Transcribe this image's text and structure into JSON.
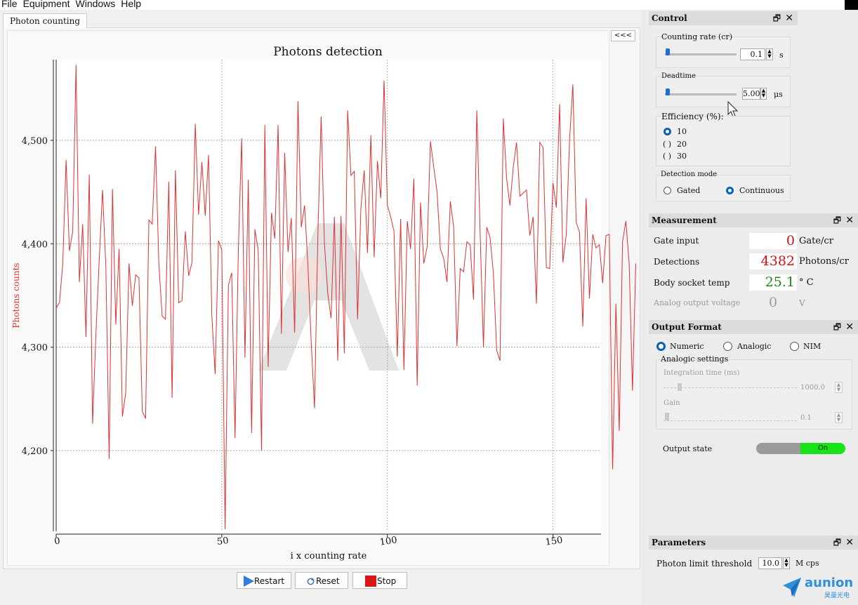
{
  "menu": [
    "File",
    "Equipment",
    "Windows",
    "Help"
  ],
  "tab": {
    "label": "Photon counting"
  },
  "collapse_label": "<<<",
  "chart_data": {
    "type": "line",
    "title": "Photons detection",
    "xlabel": "i x counting rate",
    "ylabel": "Photons counts",
    "xlim": [
      0,
      164.5
    ],
    "ylim": [
      4122,
      4578
    ],
    "xticks": [
      0,
      50,
      100,
      150
    ],
    "yticks": [
      4200,
      4300,
      4400,
      4500
    ],
    "ytick_labels": [
      "4,200",
      "4,300",
      "4,400",
      "4,500"
    ],
    "line_color": "#e03030",
    "grid": true,
    "series": [
      {
        "values": [
          4338,
          4343,
          4381,
          4481,
          4393,
          4412,
          4573,
          4363,
          4419,
          4310,
          4467,
          4226,
          4313,
          4384,
          4452,
          4378,
          4192,
          4453,
          4322,
          4395,
          4233,
          4256,
          4381,
          4340,
          4370,
          4367,
          4238,
          4231,
          4423,
          4419,
          4494,
          4381,
          4330,
          4327,
          4460,
          4251,
          4471,
          4343,
          4345,
          4412,
          4369,
          4382,
          4516,
          4428,
          4479,
          4427,
          4486,
          4331,
          4274,
          4403,
          4394,
          4124,
          4360,
          4372,
          4212,
          4394,
          4502,
          4290,
          4462,
          4217,
          4414,
          4394,
          4200,
          4515,
          4281,
          4430,
          4405,
          4515,
          4313,
          4488,
          4392,
          4425,
          4314,
          4538,
          4416,
          4437,
          4380,
          4305,
          4241,
          4407,
          4523,
          4400,
          4352,
          4328,
          4426,
          4287,
          4427,
          4294,
          4529,
          4466,
          4470,
          4327,
          4434,
          4471,
          4391,
          4505,
          4387,
          4480,
          4444,
          4558,
          4437,
          4426,
          4412,
          4291,
          4424,
          4278,
          4422,
          4395,
          4463,
          4263,
          4440,
          4381,
          4397,
          4499,
          4474,
          4450,
          4395,
          4386,
          4363,
          4441,
          4417,
          4301,
          4376,
          4373,
          4402,
          4399,
          4346,
          4529,
          4411,
          4300,
          4416,
          4406,
          4372,
          4297,
          4287,
          4521,
          4463,
          4437,
          4474,
          4498,
          4446,
          4449,
          4452,
          4408,
          4426,
          4342,
          4498,
          4493,
          4377,
          4376,
          4459,
          4435,
          4535,
          4382,
          4409,
          4500,
          4554,
          4421,
          4411,
          4320,
          4444,
          4347,
          4409,
          4396,
          4399,
          4362,
          4408,
          4409,
          4182,
          4342,
          4219,
          4402,
          4422,
          4381,
          4258,
          4381
        ]
      }
    ]
  },
  "buttons": {
    "restart": "Restart",
    "reset": "Reset",
    "stop": "Stop"
  },
  "control": {
    "title": "Control",
    "counting_rate": {
      "label": "Counting rate (cr)",
      "value": "0.1",
      "unit": "s"
    },
    "deadtime": {
      "label": "Deadtime",
      "value": "5.00",
      "unit": "μs"
    },
    "efficiency": {
      "label": "Efficiency (%):",
      "options": [
        "10",
        "20",
        "30"
      ],
      "selected": "10"
    },
    "detection_mode": {
      "label": "Detection mode",
      "options": [
        "Gated",
        "Continuous"
      ],
      "selected": "Continuous"
    }
  },
  "measurement": {
    "title": "Measurement",
    "gate_input": {
      "label": "Gate input",
      "value": "0",
      "unit": "Gate/cr",
      "color": "#d01010"
    },
    "detections": {
      "label": "Detections",
      "value": "4382",
      "unit": "Photons/cr",
      "color": "#d01010"
    },
    "body_temp": {
      "label": "Body socket temp",
      "value": "25.1",
      "unit": "° C",
      "color": "#1a8a1a"
    },
    "analog_voltage": {
      "label": "Analog output voltage",
      "value": "0",
      "unit": "V"
    }
  },
  "output_format": {
    "title": "Output Format",
    "options": [
      "Numeric",
      "Analogic",
      "NIM"
    ],
    "selected": "Numeric",
    "analogic_settings": {
      "label": "Analogic settings",
      "integration_time": {
        "label": "Integration time (ms)",
        "value": "1000.0"
      },
      "gain": {
        "label": "Gain",
        "value": "0.1"
      }
    },
    "output_state": {
      "label": "Output state",
      "value": "On"
    }
  },
  "parameters": {
    "title": "Parameters",
    "photon_limit": {
      "label": "Photon limit threshold",
      "value": "10.0",
      "unit": "M cps"
    }
  },
  "brand": {
    "name": "aunion",
    "sub": "昊量光电",
    "color": "#2f8fd8"
  }
}
